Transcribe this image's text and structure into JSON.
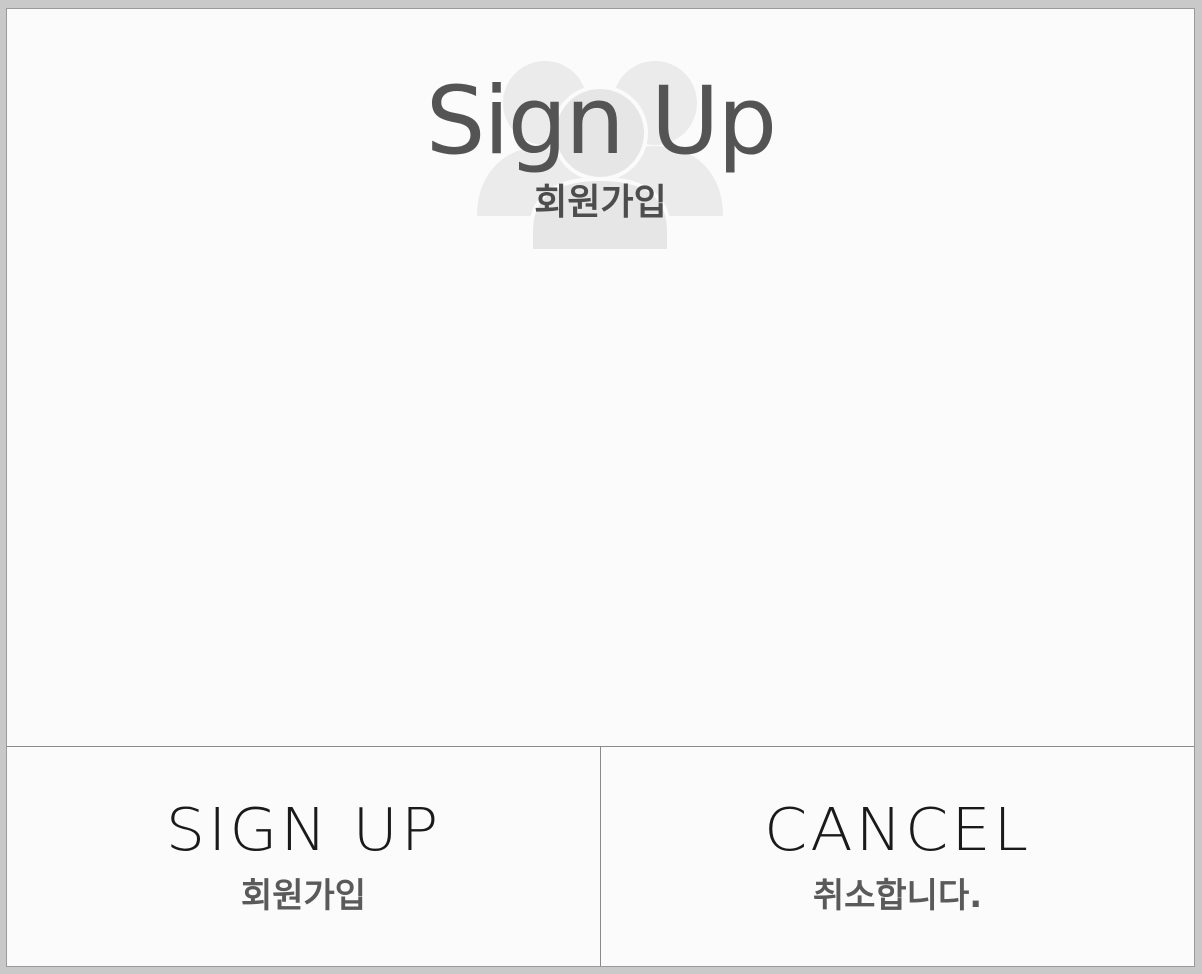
{
  "header": {
    "title": "Sign Up",
    "subtitle": "회원가입",
    "watermark_icon": "users-group-icon"
  },
  "actions": {
    "signup": {
      "label": "SIGN UP",
      "sublabel": "회원가입"
    },
    "cancel": {
      "label": "CANCEL",
      "sublabel": "취소합니다."
    }
  },
  "colors": {
    "background": "#fbfbfb",
    "title": "#545454",
    "watermark": "#e9e9e9",
    "divider": "#8a8a8a",
    "button_text": "#1a1a1a",
    "button_subtext": "#5a5a5a"
  }
}
